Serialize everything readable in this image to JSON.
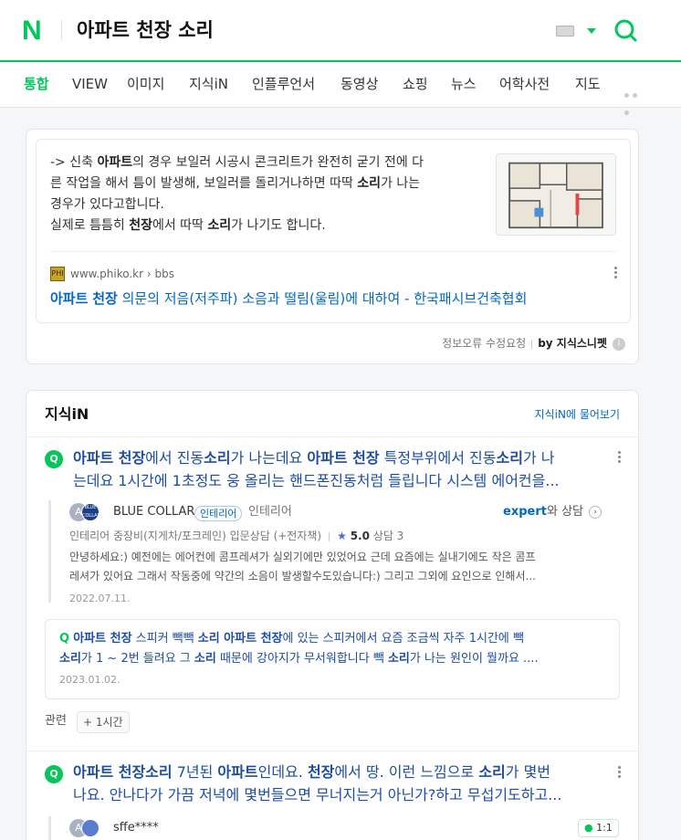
{
  "header": {
    "logo": "N",
    "query": "아파트 천장 소리",
    "keyboard_icon": "keyboard-icon",
    "search_icon": "search-icon"
  },
  "tabs": [
    "통합",
    "VIEW",
    "이미지",
    "지식iN",
    "인플루언서",
    "동영상",
    "쇼핑",
    "뉴스",
    "어학사전",
    "지도"
  ],
  "snippet": {
    "lines": [
      [
        "-> 신축 ",
        "아파트",
        "의 경우 보일러 시공시 콘크리트가 완전히 굳기 전에 다"
      ],
      [
        "른 작업을 해서 틈이 발생해, 보일러를 돌리거나하면 따딱 ",
        "소리",
        "가 나는"
      ],
      [
        "경우가 있다고합니다.",
        "",
        ""
      ],
      [
        "실제로 틈틈히 ",
        "천장",
        "에서 따딱 "
      ]
    ],
    "line4_b2": "소리",
    "line4_tail": "가 나기도 합니다.",
    "source_url": "www.phiko.kr › bbs",
    "favicon_text": "PHI",
    "title_b1": "아파트",
    "title_b2": "천장",
    "title_rest": " 의문의 저음(저주파) 소음과 떨림(울림)에 대하여 - 한국패시브건축협회",
    "report": "정보오류 수정요청",
    "by": "by 지식스니펫",
    "info": "i"
  },
  "kin": {
    "title": "지식iN",
    "ask_more": "지식iN에 물어보기",
    "q1": {
      "icon": "Q",
      "parts": [
        [
          "아파트 천장",
          true
        ],
        [
          "에서 진동",
          false
        ],
        [
          "소리",
          true
        ],
        [
          "가 나는데요 ",
          false
        ],
        [
          "아파트 천장",
          true
        ],
        [
          " 특정부위에서 진동",
          false
        ],
        [
          "소리",
          true
        ],
        [
          "가 나",
          false
        ]
      ],
      "line2": "는데요 1시간에 1초정도 웅 올리는 핸드폰진동처럼 들립니다 시스템 에어컨을...",
      "avatar": "A",
      "avatar2": "BLUE COLLAR",
      "user": "BLUE COLLAR",
      "badge": "인테리어",
      "role": "인테리어",
      "expert": "expert",
      "expert_tail": "와 상담",
      "go": "›",
      "meta_pre": "인테리어 중장비(지게차/포크레인) 입문상담 (+전자책)",
      "star": "★",
      "rating": "5.0",
      "meta_post": " 상담 3",
      "answer_line1": "안녕하세요:) 예전에는 에어컨에 콤프레셔가 실외기에만 있었어요 근데 요즘에는 실내기에도 작은 콤프",
      "answer_line2": "레셔가 있어요 그래서 작동중에 약간의 소음이 발생할수도있습니다:) 그리고 그외에 요인으로 인해서...",
      "date": "2022.07.11.",
      "sub_q": "Q",
      "sub_b1": "아파트 천장",
      "sub_t1": " 스피커 빽빽 ",
      "sub_b2": "소리 아파트 천장",
      "sub_t2": "에 있는 스피커에서 요즘 조금씩 자주 1시간에 빽",
      "sub_b3": "소리",
      "sub_t3": "가 1 ~ 2번 들려요 그 ",
      "sub_b4": "소리",
      "sub_t4": " 때문에 강아지가 무서워합니다 빽 ",
      "sub_b5": "소리",
      "sub_t5": "가 나는 원인이 뭘까요 ....",
      "sub_date": "2023.01.02.",
      "related_label": "관련",
      "related_chip": "+ 1시간"
    },
    "q2": {
      "icon": "Q",
      "b1": "아파트 천장소리",
      "t1": " 7년된 ",
      "b2": "아파트",
      "t2": "인데요. ",
      "b3": "천장",
      "t3": "에서 땅. 이런 느낌으로 ",
      "b4": "소리",
      "t4": "가 몇번",
      "line2": "나요. 안나다가 가끔 저녁에 몇번들으면 무너지는거 아닌가?하고 무섭기도하고...",
      "avatar": "A",
      "user": "sffe****",
      "chat": "1:1",
      "chat_icon": "chat-icon"
    }
  }
}
